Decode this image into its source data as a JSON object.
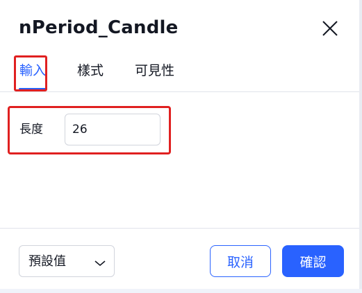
{
  "dialog": {
    "title": "nPeriod_Candle",
    "close_icon": "close-icon"
  },
  "tabs": [
    {
      "label": "輸入",
      "active": true
    },
    {
      "label": "樣式",
      "active": false
    },
    {
      "label": "可見性",
      "active": false
    }
  ],
  "inputs": {
    "length_label": "長度",
    "length_value": "26"
  },
  "footer": {
    "defaults_label": "預設值",
    "cancel_label": "取消",
    "confirm_label": "確認"
  },
  "colors": {
    "accent": "#2962ff",
    "highlight": "#e02020",
    "text": "#131722",
    "border": "#d1d4dc"
  }
}
